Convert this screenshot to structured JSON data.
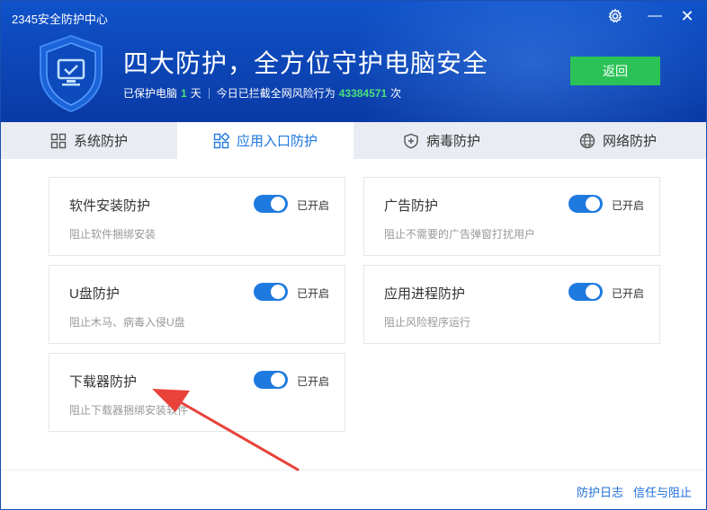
{
  "window": {
    "title": "2345安全防护中心",
    "controls": {
      "settings_icon": "gear-icon",
      "minimize_label": "—",
      "close_label": "✕"
    }
  },
  "header": {
    "headline": "四大防护，全方位守护电脑安全",
    "protected_prefix": "已保护电脑",
    "protected_days": "1",
    "protected_suffix": "天",
    "blocked_prefix": "今日已拦截全网风险行为",
    "blocked_count": "43384571",
    "blocked_suffix": "次",
    "back_label": "返回",
    "accent_color": "#2bc357"
  },
  "tabs": [
    {
      "label": "系统防护",
      "icon": "grid-icon",
      "active": false
    },
    {
      "label": "应用入口防护",
      "icon": "apps-icon",
      "active": true
    },
    {
      "label": "病毒防护",
      "icon": "shield-plus-icon",
      "active": false
    },
    {
      "label": "网络防护",
      "icon": "globe-icon",
      "active": false
    }
  ],
  "cards": [
    {
      "title": "软件安装防护",
      "desc": "阻止软件捆绑安装",
      "state": "已开启",
      "on": true
    },
    {
      "title": "广告防护",
      "desc": "阻止不需要的广告弹窗打扰用户",
      "state": "已开启",
      "on": true
    },
    {
      "title": "U盘防护",
      "desc": "阻止木马、病毒入侵U盘",
      "state": "已开启",
      "on": true
    },
    {
      "title": "应用进程防护",
      "desc": "阻止风险程序运行",
      "state": "已开启",
      "on": true
    },
    {
      "title": "下载器防护",
      "desc": "阻止下载器捆绑安装软件",
      "state": "已开启",
      "on": true
    }
  ],
  "footer": {
    "log_label": "防护日志",
    "trust_label": "信任与阻止"
  },
  "colors": {
    "header_blue": "#0f52c9",
    "toggle_blue": "#1f7ae0",
    "annotation_red": "#e8423a"
  }
}
